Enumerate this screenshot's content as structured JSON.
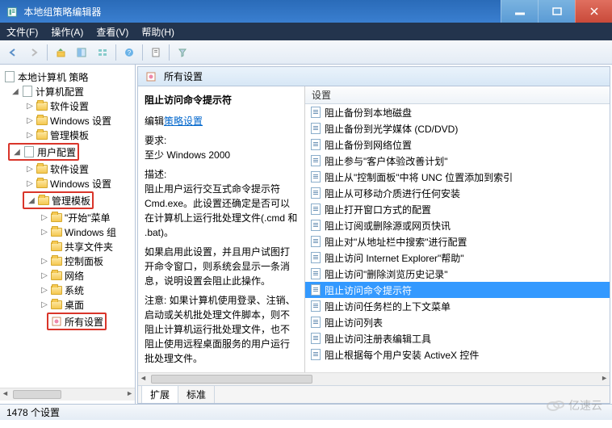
{
  "window": {
    "title": "本地组策略编辑器"
  },
  "menu": {
    "file": "文件(F)",
    "action": "操作(A)",
    "view": "查看(V)",
    "help": "帮助(H)"
  },
  "tree": {
    "root": "本地计算机 策略",
    "computer": "计算机配置",
    "c_soft": "软件设置",
    "c_win": "Windows 设置",
    "c_adm": "管理模板",
    "user": "用户配置",
    "u_soft": "软件设置",
    "u_win": "Windows 设置",
    "u_adm": "管理模板",
    "start": "\"开始\"菜单",
    "wincomp": "Windows 组",
    "shared": "共享文件夹",
    "cpanel": "控制面板",
    "network": "网络",
    "system": "系统",
    "desktop": "桌面",
    "allset": "所有设置"
  },
  "detail": {
    "header": "所有设置",
    "heading": "阻止访问命令提示符",
    "edit_prefix": "编辑",
    "edit_link": "策略设置",
    "req_label": "要求:",
    "req_value": "至少 Windows 2000",
    "desc_label": "描述:",
    "desc1": "阻止用户运行交互式命令提示符 Cmd.exe。此设置还确定是否可以在计算机上运行批处理文件(.cmd 和 .bat)。",
    "desc2": "如果启用此设置，并且用户试图打开命令窗口，则系统会显示一条消息，说明设置会阻止此操作。",
    "desc3": "注意: 如果计算机使用登录、注销、启动或关机批处理文件脚本，则不阻止计算机运行批处理文件，也不阻止使用远程桌面服务的用户运行批处理文件。"
  },
  "cols": {
    "setting": "设置"
  },
  "items": [
    "阻止备份到本地磁盘",
    "阻止备份到光学媒体 (CD/DVD)",
    "阻止备份到网络位置",
    "阻止参与\"客户体验改善计划\"",
    "阻止从\"控制面板\"中将 UNC 位置添加到索引",
    "阻止从可移动介质进行任何安装",
    "阻止打开窗口方式的配置",
    "阻止订阅或删除源或网页快讯",
    "阻止对\"从地址栏中搜索\"进行配置",
    "阻止访问 Internet Explorer\"帮助\"",
    "阻止访问\"删除浏览历史记录\"",
    "阻止访问命令提示符",
    "阻止访问任务栏的上下文菜单",
    "阻止访问列表",
    "阻止访问注册表编辑工具",
    "阻止根据每个用户安装 ActiveX 控件"
  ],
  "selected_index": 11,
  "tabs": {
    "ext": "扩展",
    "std": "标准"
  },
  "status": "1478 个设置",
  "watermark": "亿速云"
}
